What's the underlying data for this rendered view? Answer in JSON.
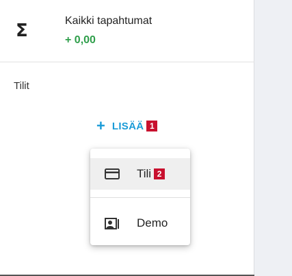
{
  "summary": {
    "icon": "sigma-icon",
    "title": "Kaikki tapahtumat",
    "amount": "+ 0,00",
    "amount_color": "#2e9e4a"
  },
  "accounts_section": {
    "label": "Tilit"
  },
  "add_button": {
    "icon": "plus-icon",
    "label": "LISÄÄ",
    "badge": "1",
    "color": "#1a9bd7"
  },
  "menu": {
    "items": [
      {
        "icon": "credit-card-icon",
        "label": "Tili",
        "badge": "2",
        "selected": true
      },
      {
        "icon": "demo-portrait-icon",
        "label": "Demo"
      }
    ]
  },
  "badge_color": "#c8102e"
}
